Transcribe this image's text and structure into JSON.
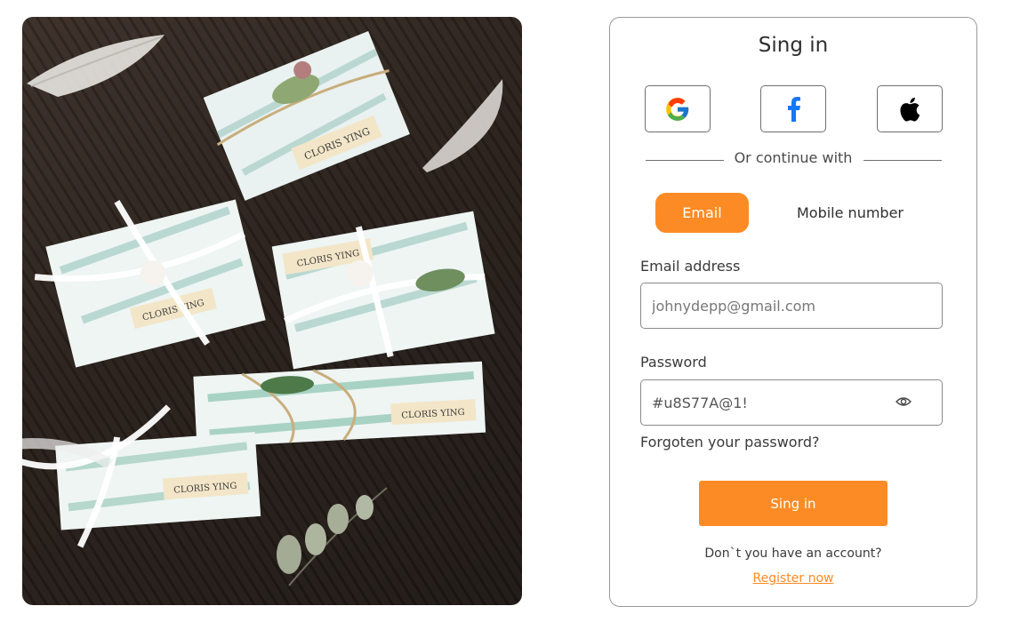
{
  "photo": {
    "box_label_1": "CLORIS YING",
    "box_label_2": "CLORIS YING",
    "box_label_3": "CLORIS YING",
    "box_label_4": "CLORIS YING",
    "box_label_5": "CLORIS YING"
  },
  "card": {
    "title": "Sing in",
    "divider_text": "Or continue with",
    "social": [
      {
        "name": "google-icon"
      },
      {
        "name": "facebook-icon"
      },
      {
        "name": "apple-icon"
      }
    ],
    "tabs": {
      "email": "Email",
      "mobile": "Mobile number"
    },
    "email": {
      "label": "Email address",
      "placeholder": "johnydepp@gmail.com"
    },
    "password": {
      "label": "Password",
      "value": "#u8S77A@1!"
    },
    "forgot": "Forgoten your password?",
    "signin_button": "Sing in",
    "no_account": "Don`t you have an account?",
    "register": "Register now"
  },
  "colors": {
    "accent": "#fd8b25",
    "border": "#8a8a8a"
  }
}
